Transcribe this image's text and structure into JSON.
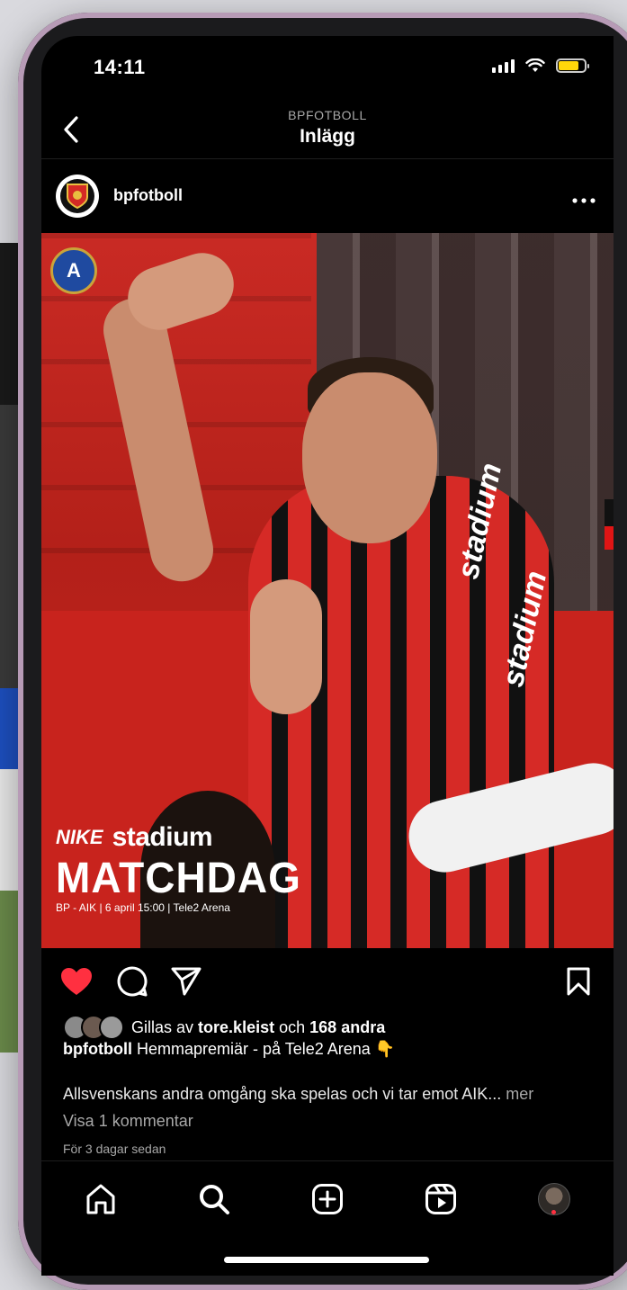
{
  "status_bar": {
    "time": "14:11",
    "battery_color": "#ffd60a"
  },
  "nav": {
    "subtitle": "BPFOTBOLL",
    "title": "Inlägg",
    "back_icon": "chevron-left-icon"
  },
  "post": {
    "username": "bpfotboll",
    "more_icon": "ellipsis-icon",
    "image": {
      "brand_nike": "NIKE",
      "brand_stadium": "stadium",
      "headline": "MATCHDAG",
      "match_info": "BP - AIK | 6 april 15:00 | Tele2 Arena",
      "shirt_sponsor": "stadium",
      "crest_letter": "A"
    },
    "actions": {
      "liked": true,
      "like_color": "#ff3040"
    },
    "likes": {
      "prefix": "Gillas av",
      "user": "tore.kleist",
      "joiner": "och",
      "others": "168 andra"
    },
    "caption": {
      "user": "bpfotboll",
      "text": "Hemmapremiär - på Tele2 Arena",
      "emoji": "👇"
    },
    "body": {
      "text": "Allsvenskans andra omgång ska spelas och vi tar emot AIK...",
      "more": "mer"
    },
    "comments_link": "Visa 1 kommentar",
    "timestamp": "För 3 dagar sedan"
  },
  "tabbar": {
    "items": [
      "home-icon",
      "search-icon",
      "create-icon",
      "reels-icon",
      "profile-avatar"
    ],
    "notification_color": "#ff3040"
  }
}
